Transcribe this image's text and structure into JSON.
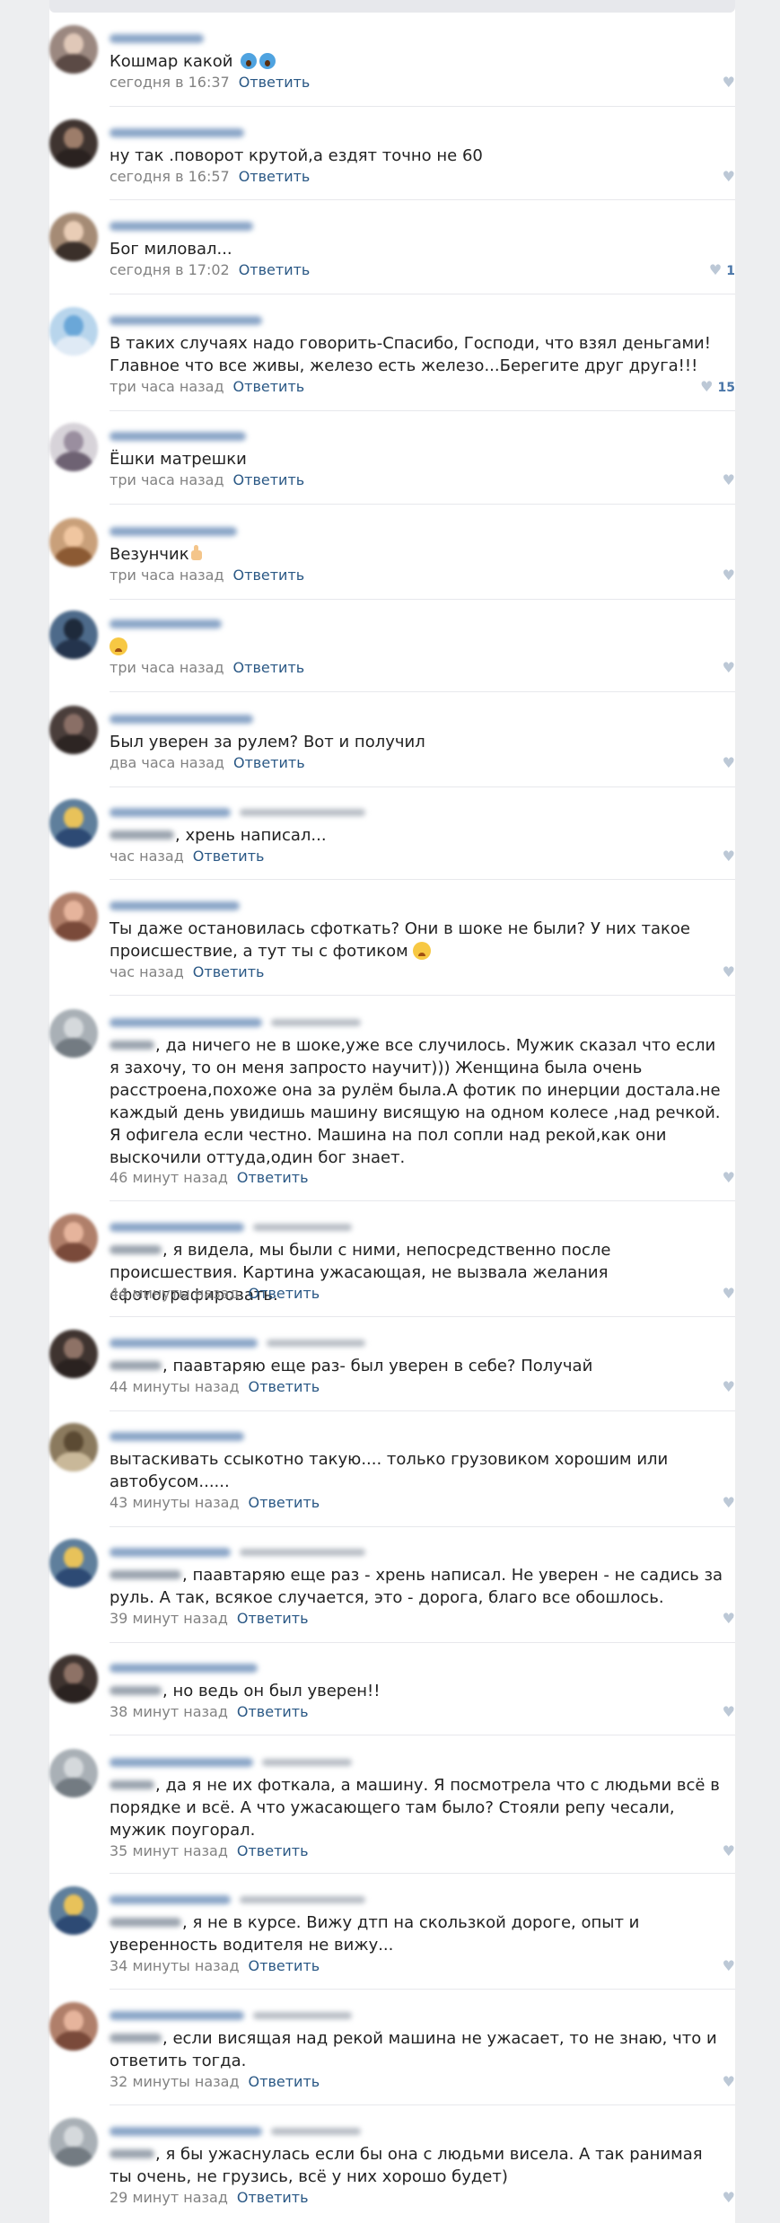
{
  "icons": {
    "like": "heart-icon"
  },
  "colors": {
    "link": "#2a5885",
    "meta": "#828282",
    "text": "#222222",
    "like": "#bcc8d6"
  },
  "comments": [
    {
      "text": "Кошмар какой",
      "time": "сегодня в 16:37",
      "reply": "Ответить",
      "likes": ""
    },
    {
      "text": "ну так .поворот крутой,а ездят точно не 60",
      "time": "сегодня в 16:57",
      "reply": "Ответить",
      "likes": ""
    },
    {
      "text": "Бог миловал...",
      "time": "сегодня в 17:02",
      "reply": "Ответить",
      "likes": "1"
    },
    {
      "text": "В таких случаях надо говорить-Спасибо, Господи, что взял деньгами! Главное что все живы, железо есть железо...Берегите друг друга!!!",
      "time": "три часа назад",
      "reply": "Ответить",
      "likes": "15"
    },
    {
      "text": "Ёшки матрешки",
      "time": "три часа назад",
      "reply": "Ответить",
      "likes": ""
    },
    {
      "text": "Везунчик",
      "time": "три часа назад",
      "reply": "Ответить",
      "likes": ""
    },
    {
      "text": "",
      "time": "три часа назад",
      "reply": "Ответить",
      "likes": ""
    },
    {
      "text": "Был уверен за рулем? Вот и получил",
      "time": "два часа назад",
      "reply": "Ответить",
      "likes": ""
    },
    {
      "text": ", хрень написал...",
      "time": "час назад",
      "reply": "Ответить",
      "likes": ""
    },
    {
      "text": "Ты даже остановилась сфоткать? Они в шоке не были? У них такое происшествие, а тут ты с фотиком",
      "time": "час назад",
      "reply": "Ответить",
      "likes": ""
    },
    {
      "text": ", да ничего не в шоке,уже все случилось. Мужик сказал что если я захочу, то он меня запросто научит))) Женщина была очень расстроена,похоже она за рулём была.А фотик по инерции достала.не каждый день увидишь машину висящую на одном колесе ,над речкой. Я офигела если честно. Машина на пол сопли над рекой,как они выскочили оттуда,один бог знает.",
      "time": "46 минут назад",
      "reply": "Ответить",
      "likes": ""
    },
    {
      "text": ", я видела, мы были с ними, непосредственно после происшествия. Картина ужасающая, не вызвала желания сфотографировать.",
      "time": "44 минуты назад",
      "reply": "Ответить",
      "likes": ""
    },
    {
      "text": ", паавтаряю еще раз- был уверен в себе? Получай",
      "time": "44 минуты назад",
      "reply": "Ответить",
      "likes": ""
    },
    {
      "text": "вытаскивать ссыкотно такую.... только грузовиком хорошим или автобусом......",
      "time": "43 минуты назад",
      "reply": "Ответить",
      "likes": ""
    },
    {
      "text": ", паавтаряю еще раз - хрень написал. Не уверен - не садись за руль. А так, всякое случается, это - дорога, благо все обошлось.",
      "time": "39 минут назад",
      "reply": "Ответить",
      "likes": ""
    },
    {
      "text": ", но ведь он был уверен!!",
      "time": "38 минут назад",
      "reply": "Ответить",
      "likes": ""
    },
    {
      "text": ", да я не их фоткала, а машину. Я посмотрела что с людьми всё в порядке и всё. А что ужасающего там было? Стояли репу чесали, мужик поугорал.",
      "time": "35 минут назад",
      "reply": "Ответить",
      "likes": ""
    },
    {
      "text": ", я не в курсе. Вижу дтп на скользкой дороге, опыт и уверенность водителя не вижу...",
      "time": "34 минуты назад",
      "reply": "Ответить",
      "likes": ""
    },
    {
      "text": ", если висящая над рекой машина не ужасает, то не знаю, что и ответить тогда.",
      "time": "32 минуты назад",
      "reply": "Ответить",
      "likes": ""
    },
    {
      "text": ", я бы ужаснулась если бы она с людьми висела. А так ранимая ты очень, не грузись, всё у них хорошо будет)",
      "time": "29 минут назад",
      "reply": "Ответить",
      "likes": ""
    }
  ]
}
